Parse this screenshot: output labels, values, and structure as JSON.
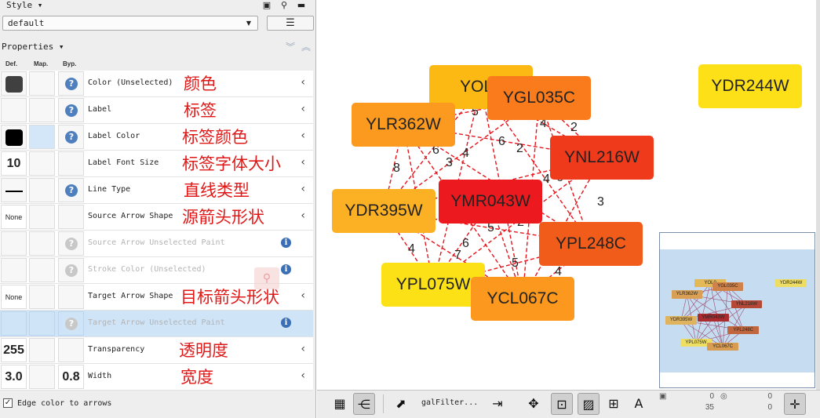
{
  "style_panel": {
    "title": "Style",
    "title_arrow": "▾",
    "dock_icon": "window-icon",
    "pin_icon": "pin-icon",
    "minimize_icon": "minimize-icon",
    "preset_value": "default",
    "menu_icon": "hamburger-menu-icon"
  },
  "properties": {
    "title": "Properties",
    "title_arrow": "▾",
    "expand_icon": "double-chevron-down-icon",
    "collapse_icon": "double-chevron-up-icon",
    "col_def": "Def.",
    "col_map": "Map.",
    "col_byp": "Byp.",
    "rows": [
      {
        "name": "Color (Unselected)",
        "annotation": "颜色",
        "def_type": "swatch",
        "def_color": "#404040",
        "def_text": "",
        "map_highlight": false,
        "byp_text": "",
        "help": true,
        "dim": false,
        "right": "chevron",
        "selected": false
      },
      {
        "name": "Label",
        "annotation": "标签",
        "def_type": "empty",
        "def_color": "",
        "def_text": "",
        "map_highlight": false,
        "byp_text": "",
        "help": true,
        "dim": false,
        "right": "chevron",
        "selected": false
      },
      {
        "name": "Label Color",
        "annotation": "标签颜色",
        "def_type": "swatch",
        "def_color": "#000000",
        "def_text": "",
        "map_highlight": true,
        "byp_text": "",
        "help": true,
        "dim": false,
        "right": "chevron",
        "selected": false
      },
      {
        "name": "Label Font Size",
        "annotation": "标签字体大小",
        "def_type": "text",
        "def_color": "",
        "def_text": "10",
        "map_highlight": false,
        "byp_text": "",
        "help": false,
        "dim": false,
        "right": "chevron",
        "selected": false
      },
      {
        "name": "Line Type",
        "annotation": "直线类型",
        "def_type": "line",
        "def_color": "",
        "def_text": "",
        "map_highlight": false,
        "byp_text": "",
        "help": true,
        "dim": false,
        "right": "chevron",
        "selected": false
      },
      {
        "name": "Source Arrow Shape",
        "annotation": "源箭头形状",
        "def_type": "small",
        "def_color": "",
        "def_text": "None",
        "map_highlight": false,
        "byp_text": "",
        "help": false,
        "dim": false,
        "right": "chevron",
        "selected": false
      },
      {
        "name": "Source Arrow Unselected Paint",
        "annotation": "",
        "def_type": "empty",
        "def_color": "",
        "def_text": "",
        "map_highlight": false,
        "byp_text": "",
        "help": true,
        "dim": true,
        "right": "info",
        "selected": false
      },
      {
        "name": "Stroke Color (Unselected)",
        "annotation": "",
        "def_type": "empty",
        "def_color": "",
        "def_text": "",
        "map_highlight": false,
        "byp_text": "",
        "help": true,
        "dim": true,
        "right": "info",
        "selected": false
      },
      {
        "name": "Target Arrow Shape",
        "annotation": "目标箭头形状",
        "def_type": "small",
        "def_color": "",
        "def_text": "None",
        "map_highlight": false,
        "byp_text": "",
        "help": false,
        "dim": false,
        "right": "chevron",
        "selected": false
      },
      {
        "name": "Target Arrow Unselected Paint",
        "annotation": "",
        "def_type": "empty",
        "def_color": "",
        "def_text": "",
        "map_highlight": false,
        "byp_text": "",
        "help": true,
        "dim": true,
        "right": "info",
        "selected": true
      },
      {
        "name": "Transparency",
        "annotation": "透明度",
        "def_type": "text",
        "def_color": "",
        "def_text": "255",
        "map_highlight": false,
        "byp_text": "",
        "help": false,
        "dim": false,
        "right": "chevron",
        "selected": false
      },
      {
        "name": "Width",
        "annotation": "宽度",
        "def_type": "text",
        "def_color": "",
        "def_text": "3.0",
        "map_highlight": false,
        "byp_text": "0.8",
        "help": false,
        "dim": false,
        "right": "chevron",
        "selected": false
      }
    ],
    "edge_to_arrows_label": "Edge color to arrows",
    "edge_to_arrows_checked": true
  },
  "network": {
    "nodes": [
      {
        "id": "YOL",
        "label": "YOL0",
        "color": "#fcb813"
      },
      {
        "id": "YGL035C",
        "label": "YGL035C",
        "color": "#fa7b1c"
      },
      {
        "id": "YLR362W",
        "label": "YLR362W",
        "color": "#fb9a1e"
      },
      {
        "id": "YNL216W",
        "label": "YNL216W",
        "color": "#ef3a1c"
      },
      {
        "id": "YMR043W",
        "label": "YMR043W",
        "color": "#ec1a1f"
      },
      {
        "id": "YDR395W",
        "label": "YDR395W",
        "color": "#fcb124"
      },
      {
        "id": "YPL248C",
        "label": "YPL248C",
        "color": "#f25c1b"
      },
      {
        "id": "YPL075W",
        "label": "YPL075W",
        "color": "#fde117"
      },
      {
        "id": "YCL067C",
        "label": "YCL067C",
        "color": "#fb981d"
      },
      {
        "id": "YDR244W",
        "label": "YDR244W",
        "color": "#fde018"
      }
    ],
    "edge_color": "#e8141c",
    "edge_labels": [
      "5",
      "4",
      "2",
      "6",
      "2",
      "6",
      "3",
      "4",
      "8",
      "4",
      "4",
      "3",
      "2",
      "5",
      "6",
      "7",
      "4",
      "5",
      "4",
      "6"
    ]
  },
  "toolbar": {
    "grid_icon": "grid-view-icon",
    "share_icon": "network-share-icon",
    "open_icon": "open-arrow-icon",
    "filter_label": "galFilter...",
    "export_icon": "export-icon",
    "fit_icon": "fit-all-icon",
    "sel_node_icon": "select-nodes-icon",
    "sel_edge_icon": "select-edges-icon",
    "sel_annot_icon": "select-annotations-icon",
    "text_icon": "annotation-text-icon",
    "node_sel_count": "0",
    "node_total": "35",
    "edge_sel_count": "0",
    "edge_total": "0",
    "navigate_icon": "navigate-icon"
  }
}
